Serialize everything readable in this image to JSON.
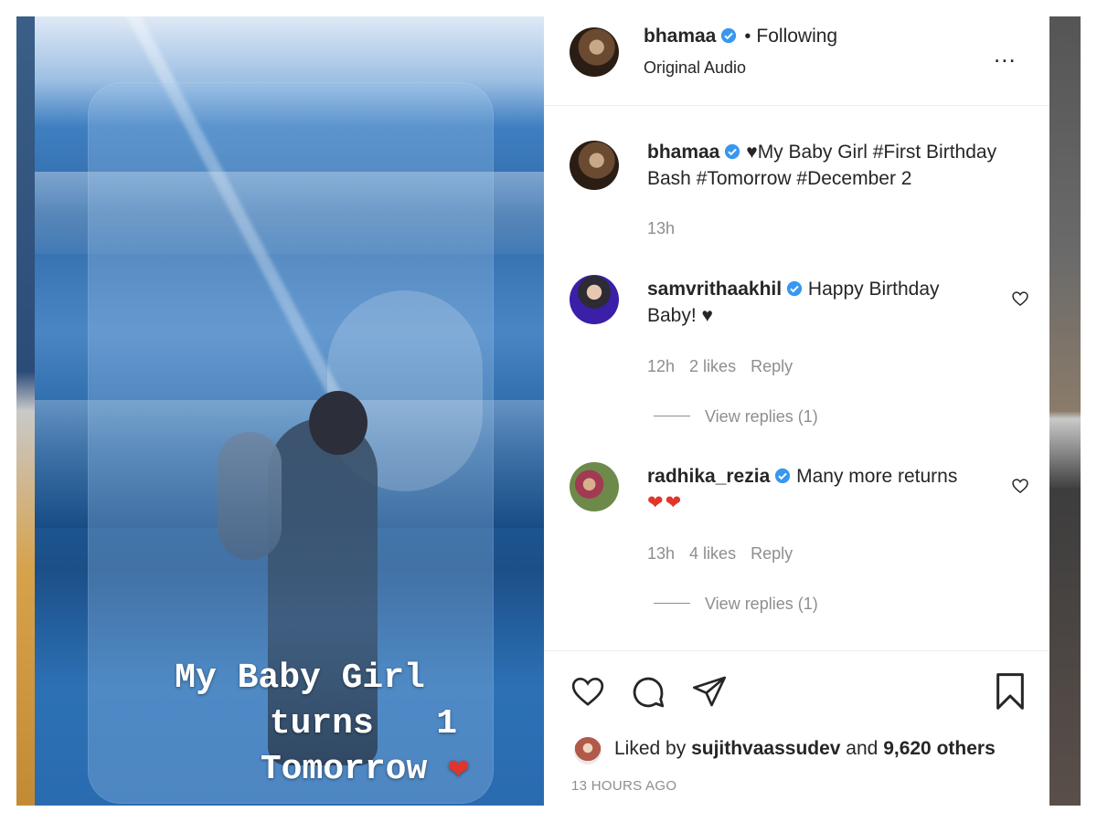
{
  "overlay": {
    "line1": "My Baby Girl",
    "line2": "turns   1",
    "line3": "Tomorrow",
    "heart": "❤"
  },
  "header": {
    "username": "bhamaa",
    "separator": "•",
    "following": "Following",
    "audio": "Original Audio",
    "more": "..."
  },
  "caption": {
    "username": "bhamaa",
    "text_line1": "♥My Baby Girl #First Birthday",
    "text_line2": "Bash #Tomorrow #December 2",
    "time": "13h"
  },
  "comments": [
    {
      "username": "samvrithaakhil",
      "text_line1": "Happy Birthday",
      "text_line2": "Baby! ♥",
      "time": "12h",
      "likes": "2 likes",
      "reply": "Reply",
      "view_replies": "View replies (1)"
    },
    {
      "username": "radhika_rezia",
      "text_line1": "Many more returns",
      "text_line2": "❤❤",
      "time": "13h",
      "likes": "4 likes",
      "reply": "Reply",
      "view_replies": "View replies (1)"
    }
  ],
  "footer": {
    "liked_prefix": "Liked by ",
    "liked_user": "sujithvaassudev",
    "liked_mid": " and ",
    "liked_count": "9,620 others",
    "time_ago": "13 HOURS AGO"
  },
  "colors": {
    "verified": "#3897f0",
    "heart_red": "#e1352b",
    "muted": "#8e8e8e",
    "text": "#262626"
  },
  "icons": [
    "verified-badge-icon",
    "heart-icon",
    "comment-icon",
    "share-icon",
    "bookmark-icon",
    "more-icon"
  ]
}
